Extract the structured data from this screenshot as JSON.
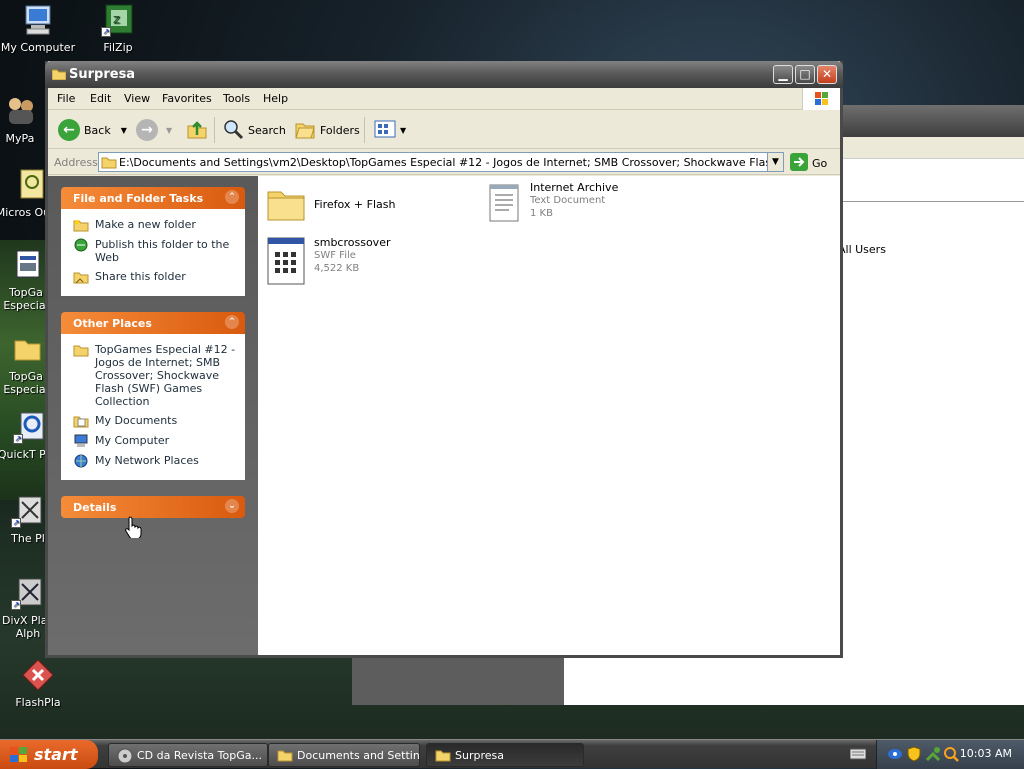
{
  "desktop": {
    "icons": [
      {
        "label": "My Computer"
      },
      {
        "label": "FilZip"
      },
      {
        "label": "MyPa"
      },
      {
        "label": "Micros Outlo"
      },
      {
        "label": "TopGa Especial"
      },
      {
        "label": "TopGa Especial"
      },
      {
        "label": "QuickT Play"
      },
      {
        "label": "The Pl"
      },
      {
        "label": "DivX Play Alph"
      },
      {
        "label": "FlashPla"
      }
    ]
  },
  "background_window": {
    "text": "All Users"
  },
  "window": {
    "title": "Surpresa",
    "menu": [
      "File",
      "Edit",
      "View",
      "Favorites",
      "Tools",
      "Help"
    ],
    "toolbar": {
      "back": "Back",
      "search": "Search",
      "folders": "Folders"
    },
    "address": {
      "label": "Address",
      "value": "E:\\Documents and Settings\\vm2\\Desktop\\TopGames Especial #12 - Jogos de Internet; SMB Crossover; Shockwave Flash (SWF) Games",
      "go": "Go"
    },
    "panels": {
      "file_tasks": {
        "title": "File and Folder Tasks",
        "items": [
          "Make a new folder",
          "Publish this folder to the Web",
          "Share this folder"
        ]
      },
      "other_places": {
        "title": "Other Places",
        "items": [
          "TopGames Especial #12 - Jogos de Internet; SMB Crossover; Shockwave Flash (SWF) Games Collection",
          "My Documents",
          "My Computer",
          "My Network Places"
        ]
      },
      "details": {
        "title": "Details"
      }
    },
    "files": [
      {
        "name": "Firefox + Flash",
        "type": "",
        "size": ""
      },
      {
        "name": "Internet Archive",
        "type": "Text Document",
        "size": "1 KB"
      },
      {
        "name": "smbcrossover",
        "type": "SWF File",
        "size": "4,522 KB"
      }
    ]
  },
  "taskbar": {
    "start": "start",
    "tasks": [
      "CD da Revista TopGa...",
      "Documents and Settings",
      "Surpresa"
    ],
    "clock": "10:03 AM"
  },
  "colors": {
    "panel_header": "#e06a1c",
    "titlebar": "#5a5a5a"
  }
}
